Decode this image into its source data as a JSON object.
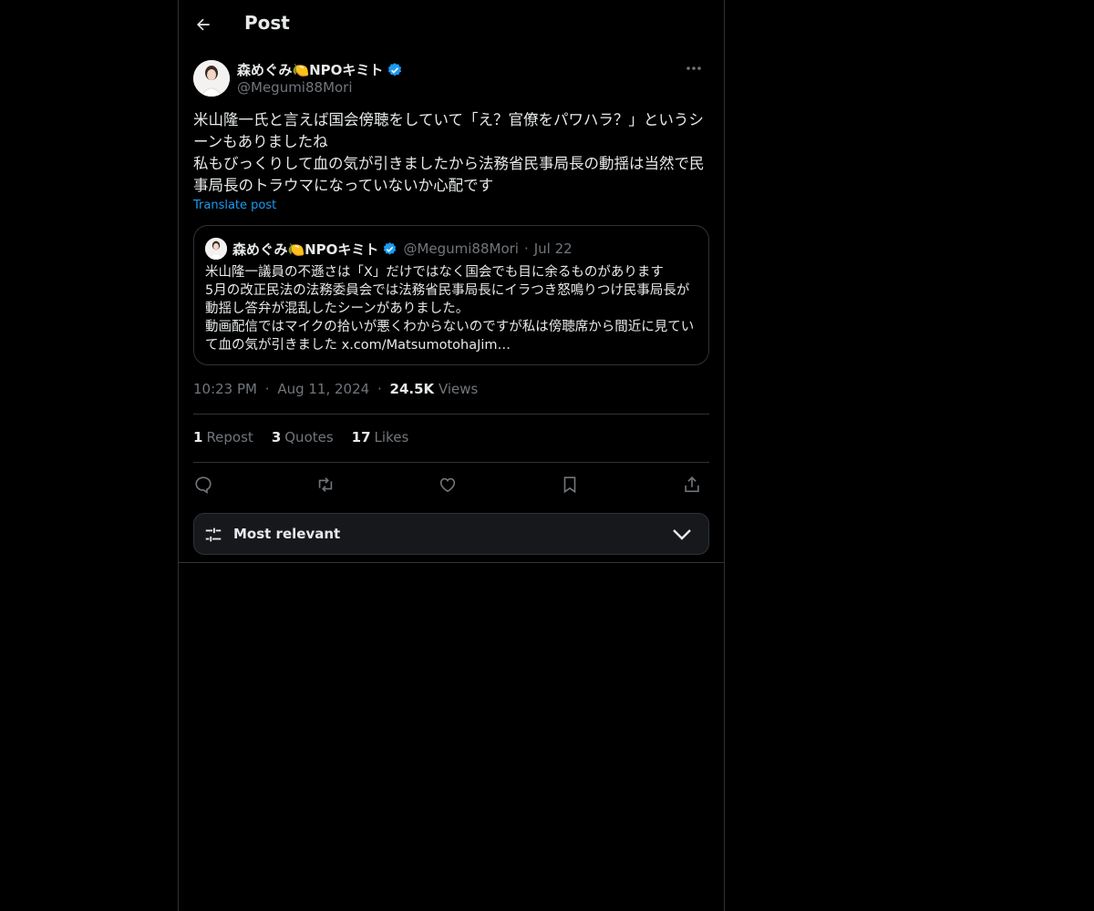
{
  "header": {
    "title": "Post",
    "back_icon": "arrow-left-icon"
  },
  "post": {
    "author_name": "森めぐみ🍋NPOキミト",
    "author_handle": "@Megumi88Mori",
    "verified_color": "#1d9bf0",
    "text": "米山隆一氏と言えば国会傍聴をしていて「え？官僚をパワハラ？」というシーンもありましたね\n私もびっくりして血の気が引きましたから法務省民事局長の動揺は当然で民事局長のトラウマになっていないか心配です",
    "translate_label": "Translate post",
    "quote": {
      "author_name": "森めぐみ🍋NPOキミト",
      "author_handle": "@Megumi88Mori",
      "separator": "·",
      "date": "Jul 22",
      "text": "米山隆一議員の不遜さは「X」だけではなく国会でも目に余るものがあります\n5月の改正民法の法務委員会では法務省民事局長にイラつき怒鳴りつけ民事局長が動揺し答弁が混乱したシーンがありました。\n動画配信ではマイクの拾いが悪くわからないのですが私は傍聴席から間近に見ていて血の気が引きました x.com/MatsumotohaJim…"
    },
    "time": "10:23 PM",
    "date": "Aug 11, 2024",
    "separator": "·",
    "views_count": "24.5K",
    "views_label": "Views",
    "stats": {
      "reposts_count": "1",
      "reposts_label": "Repost",
      "quotes_count": "3",
      "quotes_label": "Quotes",
      "likes_count": "17",
      "likes_label": "Likes"
    },
    "actions": [
      "reply-icon",
      "repost-icon",
      "like-icon",
      "bookmark-icon",
      "share-icon"
    ]
  },
  "sort": {
    "label": "Most relevant",
    "icon": "sliders-icon",
    "chevron": "chevron-down-icon"
  },
  "colors": {
    "background": "#000000",
    "border": "#2f3336",
    "accent": "#1d9bf0",
    "muted": "#71767b",
    "text": "#e7e9ea"
  }
}
